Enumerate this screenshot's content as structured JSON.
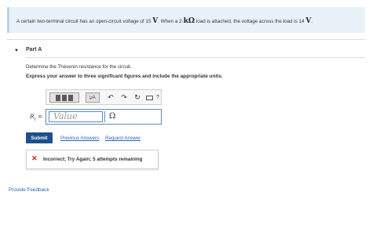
{
  "problem": {
    "text_1": "A certain two-terminal circuit has an open-circuit voltage of 15",
    "unit_v": "V",
    "text_2": ". When a 2-",
    "unit_k_ohm": "kΩ",
    "text_3": " load is attached, the voltage across the load is 14",
    "text_4": "."
  },
  "part": {
    "caret": "▼",
    "title": "Part A",
    "instruction": "Determine the Thévenin resistance for the circuit.",
    "express": "Express your answer to three significant figures and include the appropriate units."
  },
  "toolbar": {
    "mu_label": "μA",
    "undo_icon": "↶",
    "redo_icon": "↷",
    "reset_icon": "↻",
    "help_label": "?"
  },
  "answer": {
    "label_var": "R",
    "label_sub": "t",
    "label_eq": " =",
    "value_placeholder": "Value",
    "unit": "Ω"
  },
  "actions": {
    "submit": "Submit",
    "previous_answers": "Previous Answers",
    "request_answer": "Request Answer"
  },
  "feedback": {
    "icon": "✕",
    "message": "Incorrect; Try Again; 5 attempts remaining"
  },
  "footer": {
    "provide_feedback": "Provide Feedback"
  },
  "colors": {
    "submit_bg": "#1e4f8d",
    "link": "#2a63b6",
    "error": "#cc1f1f",
    "problem_bg": "#eaf2f9"
  }
}
